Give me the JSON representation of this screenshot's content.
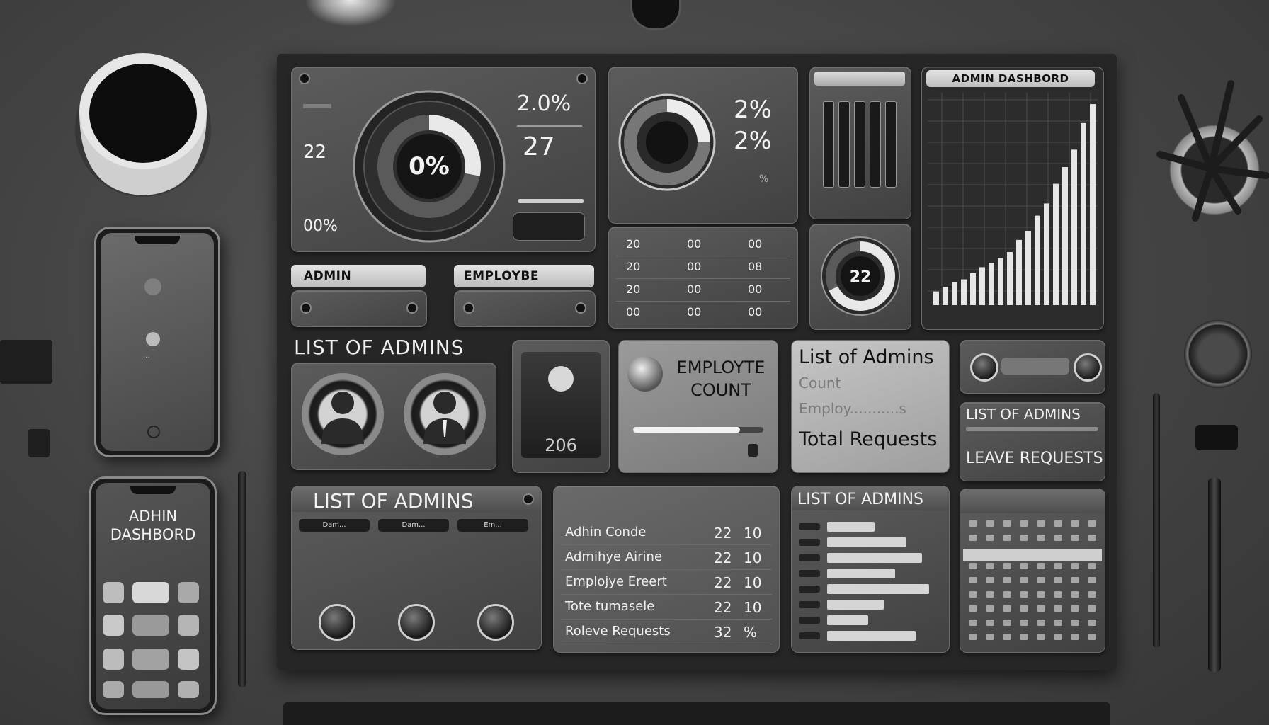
{
  "colors": {
    "background": "#474747",
    "board": "#262626",
    "panel": "#4d4d4d",
    "accent": "#e8e8e8"
  },
  "gauge_panel": {
    "left_values": [
      "22",
      "00%"
    ],
    "center": "0%",
    "right_top": "2.0%",
    "right_mid": "27",
    "progress": 0.28
  },
  "dial_panel": {
    "value_top": "2%",
    "value_bottom": "2%",
    "caption": "%"
  },
  "mini_gauge": {
    "value": "22",
    "progress": 0.68
  },
  "admin_title_panel": {
    "title": "ADMIN DASHBORD"
  },
  "growth_chart": {
    "values": [
      18,
      24,
      30,
      34,
      42,
      50,
      56,
      62,
      70,
      86,
      98,
      118,
      134,
      160,
      182,
      205,
      240,
      265
    ]
  },
  "number_table": {
    "rows": [
      [
        "20",
        "00",
        "00"
      ],
      [
        "20",
        "00",
        "08"
      ],
      [
        "20",
        "00",
        "00"
      ],
      [
        "00",
        "00",
        "00"
      ]
    ]
  },
  "role_tabs": {
    "admin": "ADMIN",
    "employee": "EMPLOYBE"
  },
  "admins_section": {
    "title": "LIST OF ADMINS"
  },
  "profile_card": {
    "value": "206"
  },
  "employee_card": {
    "title_line1": "EMPLOYTE",
    "title_line2": "COUNT",
    "progress": 0.82
  },
  "summary_card": {
    "title": "List of Admins",
    "line2": "Count",
    "line3": "Employ...........s",
    "line4": "Total Requests"
  },
  "leave_panel": {
    "heading": "LIST OF ADMINS",
    "label": "LEAVE REQUESTS"
  },
  "admins_list_panel": {
    "title": "LIST OF ADMINS",
    "columns": [
      "Dam...",
      "Dam...",
      "Em..."
    ]
  },
  "stats_table": {
    "rows": [
      {
        "label": "Adhin Conde",
        "a": "22",
        "b": "10"
      },
      {
        "label": "Admihye Airine",
        "a": "22",
        "b": "10"
      },
      {
        "label": "Emplojye Ereert",
        "a": "22",
        "b": "10"
      },
      {
        "label": "Tote tumasele",
        "a": "22",
        "b": "10"
      },
      {
        "label": "Roleve Requests",
        "a": "32",
        "b": "%"
      }
    ]
  },
  "admins_bars": {
    "title": "LIST OF ADMINS",
    "values": [
      0.42,
      0.7,
      0.84,
      0.6,
      0.9,
      0.5,
      0.36,
      0.78
    ]
  },
  "phone_top": {
    "label": "..."
  },
  "phone_bottom": {
    "title_line1": "ADHIN",
    "title_line2": "DASHBORD"
  }
}
